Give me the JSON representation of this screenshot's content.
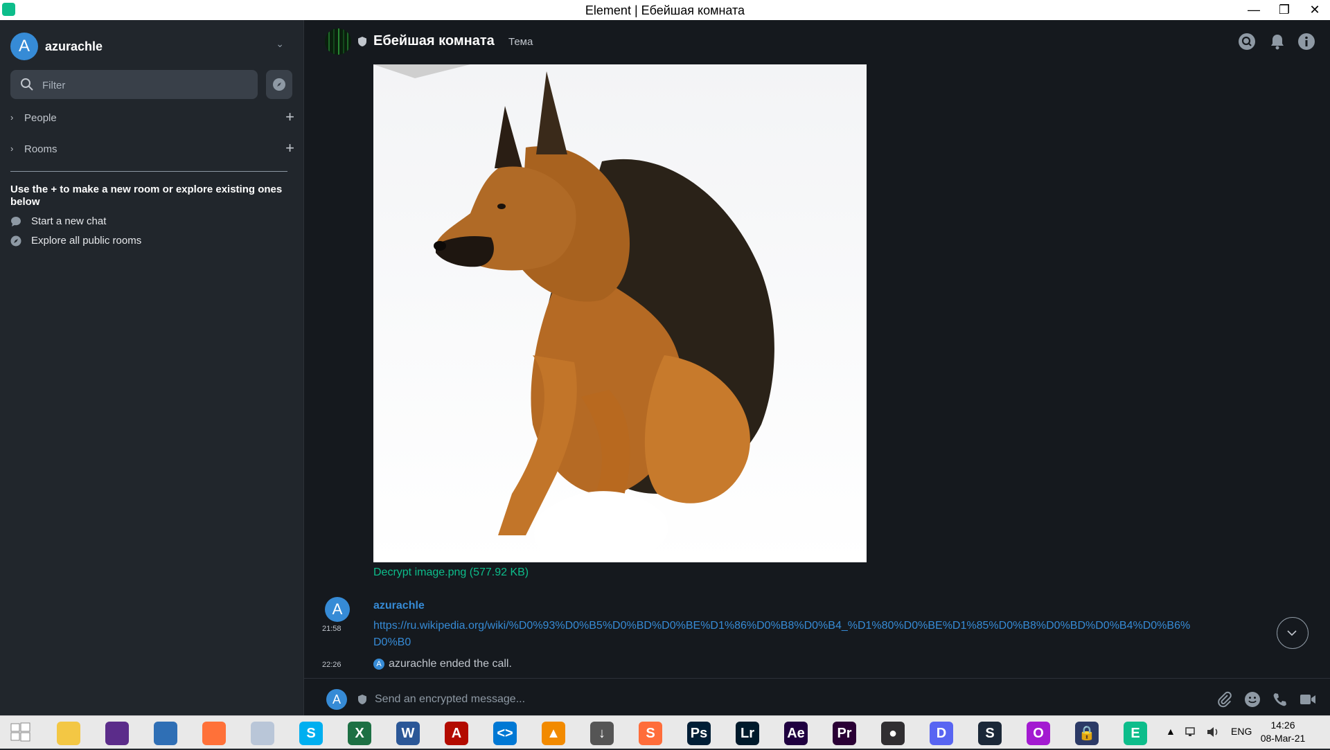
{
  "window": {
    "title": "Element | Ебейшая комната",
    "minimize_label": "—",
    "maximize_label": "❐",
    "close_label": "✕"
  },
  "sidebar": {
    "user": {
      "initial": "A",
      "name": "azurachle"
    },
    "filter_placeholder": "Filter",
    "sections": [
      {
        "label": "People"
      },
      {
        "label": "Rooms"
      }
    ],
    "hint": "Use the + to make a new room or explore existing ones below",
    "links": [
      {
        "label": "Start a new chat"
      },
      {
        "label": "Explore all public rooms"
      }
    ]
  },
  "room": {
    "name": "Ебейшая комната",
    "topic": "Тема"
  },
  "timeline": {
    "image_caption": "Decrypt image.png (577.92 KB)",
    "message": {
      "avatar_initial": "A",
      "sender": "azurachle",
      "time": "21:58",
      "link": "https://ru.wikipedia.org/wiki/%D0%93%D0%B5%D0%BD%D0%BE%D1%86%D0%B8%D0%B4_%D1%80%D0%BE%D1%85%D0%B8%D0%BD%D0%B4%D0%B6%D0%B0"
    },
    "event": {
      "time": "22:26",
      "avatar_initial": "A",
      "text": "azurachle ended the call."
    }
  },
  "composer": {
    "avatar_initial": "A",
    "placeholder": "Send an encrypted message..."
  },
  "taskbar": {
    "apps": [
      {
        "name": "start-icon",
        "color": "#ffffff"
      },
      {
        "name": "file-explorer-icon",
        "color": "#f3c744"
      },
      {
        "name": "media-app-icon",
        "color": "#5b2c8a"
      },
      {
        "name": "browser-globe-icon",
        "color": "#2f6fb5"
      },
      {
        "name": "firefox-icon",
        "color": "#ff7139"
      },
      {
        "name": "moon-app-icon",
        "color": "#b9c6d8"
      },
      {
        "name": "skype-icon",
        "color": "#00aff0",
        "letter": "S"
      },
      {
        "name": "excel-icon",
        "color": "#1d7044",
        "letter": "X"
      },
      {
        "name": "word-icon",
        "color": "#2b5797",
        "letter": "W"
      },
      {
        "name": "acrobat-icon",
        "color": "#b30b00",
        "letter": "A"
      },
      {
        "name": "vscode-icon",
        "color": "#0078d4",
        "letter": "<>"
      },
      {
        "name": "vlc-icon",
        "color": "#f28a00",
        "letter": "▲"
      },
      {
        "name": "download-manager-icon",
        "color": "#555555",
        "letter": "↓"
      },
      {
        "name": "sublime-icon",
        "color": "#ff6d3a",
        "letter": "S"
      },
      {
        "name": "photoshop-icon",
        "color": "#001e36",
        "letter": "Ps"
      },
      {
        "name": "lightroom-icon",
        "color": "#001a2b",
        "letter": "Lr"
      },
      {
        "name": "after-effects-icon",
        "color": "#1f0040",
        "letter": "Ae"
      },
      {
        "name": "premiere-icon",
        "color": "#2a0035",
        "letter": "Pr"
      },
      {
        "name": "obs-icon",
        "color": "#302e31",
        "letter": "●"
      },
      {
        "name": "discord-icon",
        "color": "#5865f2",
        "letter": "D"
      },
      {
        "name": "steam-icon",
        "color": "#1b2838",
        "letter": "S"
      },
      {
        "name": "opera-icon",
        "color": "#a31ad1",
        "letter": "O"
      },
      {
        "name": "vpn-lock-icon",
        "color": "#2b3a66",
        "letter": "🔒"
      },
      {
        "name": "element-icon",
        "color": "#0dbd8b",
        "letter": "E"
      }
    ],
    "tray_arrow": "▲",
    "language": "ENG",
    "time": "14:26",
    "date": "08-Mar-21"
  }
}
